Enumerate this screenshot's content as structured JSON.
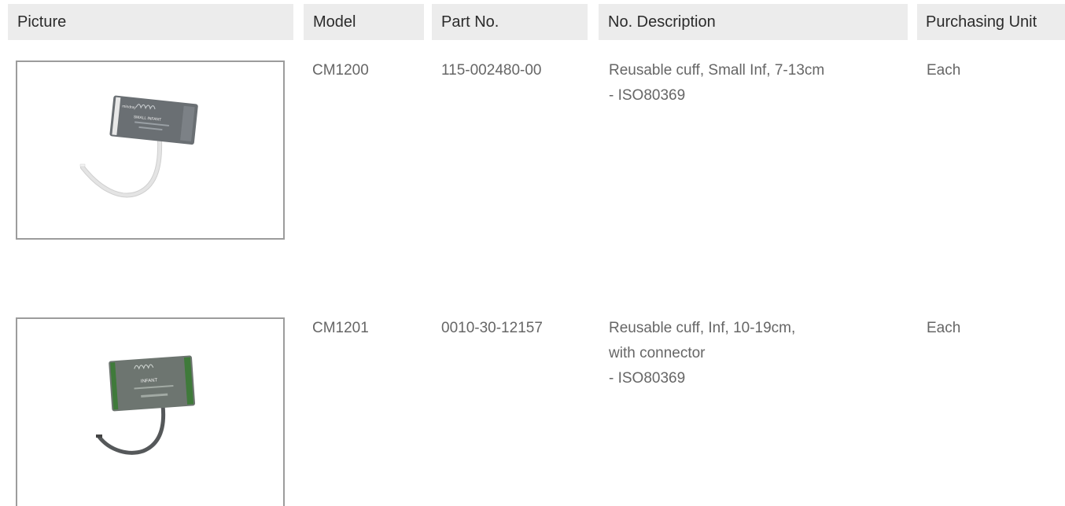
{
  "table": {
    "headers": {
      "picture": "Picture",
      "model": "Model",
      "part_no": "Part No.",
      "description": "No. Description",
      "purchasing_unit": "Purchasing Unit"
    },
    "rows": [
      {
        "model": "CM1200",
        "part_no": "115-002480-00",
        "description_lines": [
          "Reusable cuff, Small Inf, 7-13cm",
          "- ISO80369"
        ],
        "purchasing_unit": "Each",
        "image": {
          "icon": "small-infant-cuff-photo",
          "cuff_color": "#6a6f73",
          "tube_color": "#e4e4e4",
          "label_text": "SMALL INFANT"
        }
      },
      {
        "model": "CM1201",
        "part_no": "0010-30-12157",
        "description_lines": [
          "Reusable cuff, Inf, 10-19cm,",
          "with connector",
          "- ISO80369"
        ],
        "purchasing_unit": "Each",
        "image": {
          "icon": "infant-cuff-photo",
          "cuff_color": "#6d7570",
          "tube_color": "#55585a",
          "label_text": "INFANT"
        }
      }
    ]
  }
}
